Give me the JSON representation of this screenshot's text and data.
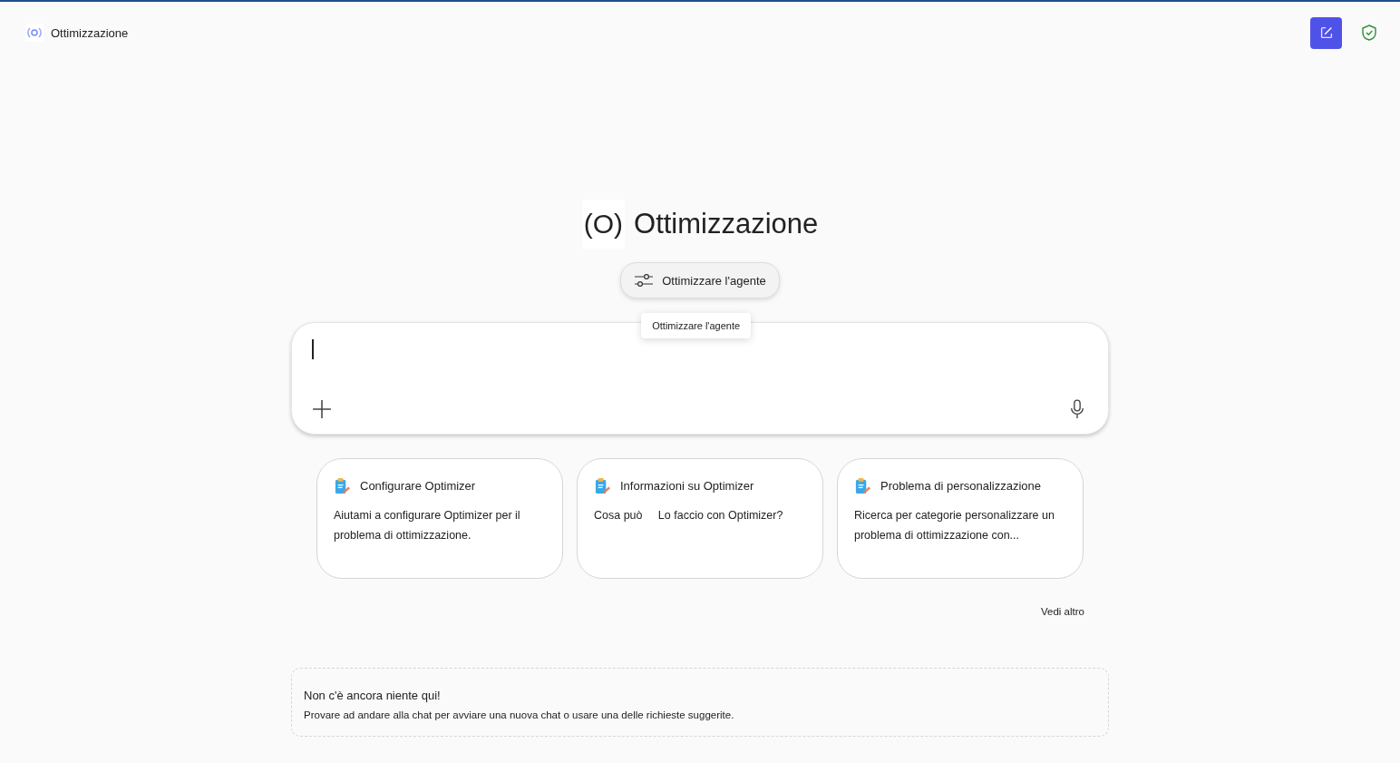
{
  "header": {
    "title": "Ottimizzazione"
  },
  "hero": {
    "logo": "(O)",
    "title": "Ottimizzazione",
    "action": "Ottimizzare l'agente",
    "tooltip": "Ottimizzare l'agente"
  },
  "prompts": [
    {
      "title": "Configurare Optimizer",
      "text": "Aiutami a configurare Optimizer per il problema di ottimizzazione."
    },
    {
      "title": "Informazioni su Optimizer",
      "text": "Cosa può     Lo faccio con Optimizer?"
    },
    {
      "title": "Problema di personalizzazione",
      "text": "Ricerca per categorie personalizzare un problema di ottimizzazione con..."
    }
  ],
  "see_more": "Vedi altro",
  "empty": {
    "title": "Non c'è ancora niente qui!",
    "text": "Provare ad andare alla chat per avviare una nuova chat o usare una delle richieste suggerite."
  }
}
